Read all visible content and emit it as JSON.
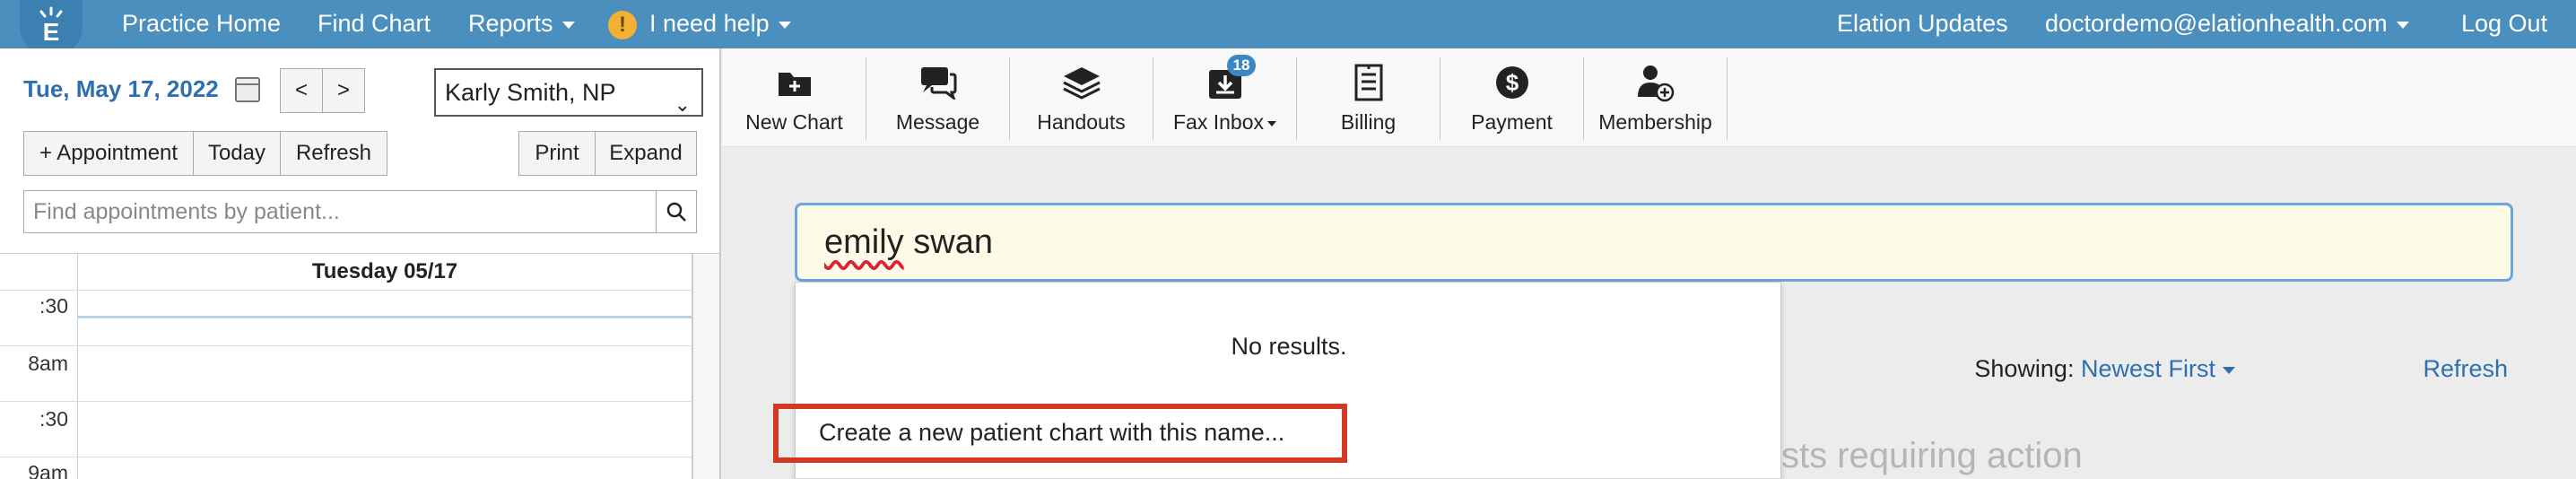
{
  "topnav": {
    "logo": "elation-logo-icon",
    "practice_home": "Practice Home",
    "find_chart": "Find Chart",
    "reports": "Reports",
    "help": "I need help",
    "updates": "Elation Updates",
    "user": "doctordemo@elationhealth.com",
    "logout": "Log Out"
  },
  "left": {
    "date": "Tue, May 17, 2022",
    "prev": "<",
    "next": ">",
    "provider": "Karly Smith, NP",
    "appointment": "+ Appointment",
    "today": "Today",
    "refresh": "Refresh",
    "print": "Print",
    "expand": "Expand",
    "search_placeholder": "Find appointments by patient...",
    "calendar_header": "Tuesday 05/17",
    "times": [
      ":30",
      "8am",
      ":30",
      "9am"
    ]
  },
  "toolbar": {
    "new_chart": "New Chart",
    "message": "Message",
    "handouts": "Handouts",
    "fax_inbox": "Fax Inbox",
    "fax_badge": "18",
    "billing": "Billing",
    "payment": "Payment",
    "membership": "Membership"
  },
  "main": {
    "search_value_1": "emily",
    "search_value_2": " swan",
    "no_results": "No results.",
    "create_link": "Create a new patient chart with this name...",
    "showing_label": "Showing:",
    "showing_value": "Newest First",
    "refresh": "Refresh",
    "bg_text": "sts requiring action"
  },
  "colors": {
    "nav_blue": "#4a8fbd",
    "link_blue": "#2e6fb0",
    "highlight_red": "#d33a23",
    "input_bg": "#fdfbe8"
  }
}
